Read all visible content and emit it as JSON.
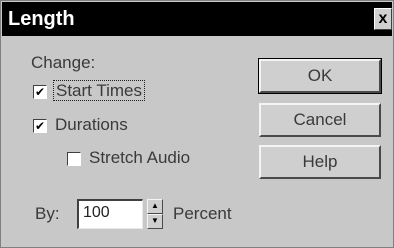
{
  "window": {
    "title": "Length",
    "close_glyph": "x"
  },
  "change_group": {
    "label": "Change:",
    "start_times": {
      "label": "Start Times",
      "checked": true,
      "mark": "✔"
    },
    "durations": {
      "label": "Durations",
      "checked": true,
      "mark": "✔"
    },
    "stretch_audio": {
      "label": "Stretch Audio",
      "checked": false,
      "mark": ""
    }
  },
  "by_row": {
    "label": "By:",
    "value": "100",
    "unit": "Percent",
    "spin_up": "▲",
    "spin_down": "▼"
  },
  "buttons": {
    "ok": "OK",
    "cancel": "Cancel",
    "help": "Help"
  }
}
